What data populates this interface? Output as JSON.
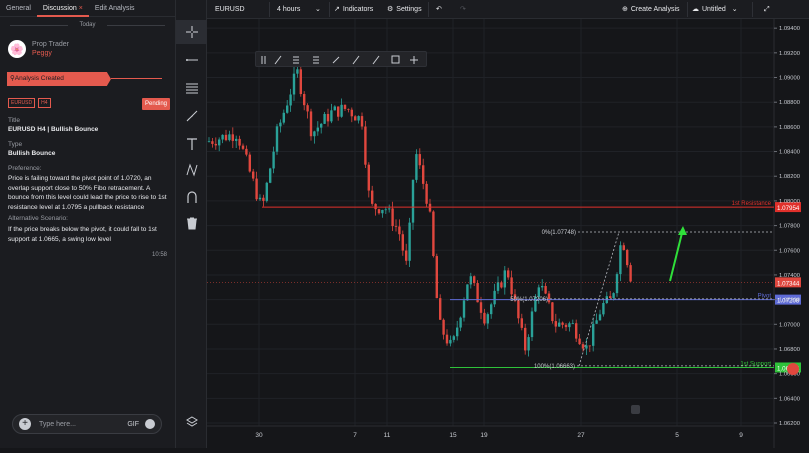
{
  "left_panel": {
    "tabs": [
      {
        "label": "General"
      },
      {
        "label": "Discussion",
        "close": "×"
      },
      {
        "label": "Edit Analysis"
      }
    ],
    "day_label": "Today",
    "user": {
      "role": "Prop Trader",
      "name": "Peggy"
    },
    "status_banner": "Analysis Created",
    "tags": [
      "EURUSD",
      "H4"
    ],
    "status_badge": "Pending",
    "title_label": "Title",
    "title_value": "EURUSD H4 | Bullish Bounce",
    "type_label": "Type",
    "type_value": "Bullish Bounce",
    "preference_label": "Preference:",
    "preference_text": "Price is failing toward the pivot point of 1.0720, an overlap support close to 50% Fibo retracement. A bounce from this level could lead the price to rise to 1st resistance level at 1.0795 a pullback resistance",
    "alt_label": "Alternative Scenario:",
    "alt_text": "If the price breaks below the pivot, it could fall  to 1st support at 1.0665, a swing low  level",
    "time": "10:58",
    "input_placeholder": "Type here...",
    "gif_label": "GIF"
  },
  "topbar": {
    "symbol": "EURUSD",
    "timeframe": "4 hours",
    "indicators": "Indicators",
    "settings": "Settings",
    "create_analysis": "Create Analysis",
    "layout_name": "Untitled"
  },
  "chart_data": {
    "type": "candlestick",
    "symbol": "EURUSD",
    "timeframe": "H4",
    "y_axis": {
      "min": 1.062,
      "max": 1.0945,
      "ticks": [
        "1.09400",
        "1.09200",
        "1.09000",
        "1.08800",
        "1.08600",
        "1.08400",
        "1.08200",
        "1.08000",
        "1.07800",
        "1.07600",
        "1.07400",
        "1.07200",
        "1.07000",
        "1.06800",
        "1.06600",
        "1.06400",
        "1.06200"
      ]
    },
    "x_axis": {
      "ticks": [
        "30",
        "7",
        "11",
        "15",
        "19",
        "27",
        "5",
        "9"
      ]
    },
    "levels": [
      {
        "name": "1st Resistance",
        "value": 1.0795,
        "label": "1.07954",
        "color": "#e0302b"
      },
      {
        "name": "Pivot",
        "value": 1.072,
        "label": "1.07208",
        "color": "#5e6bd6"
      },
      {
        "name": "1st Support",
        "value": 1.0665,
        "label": "1.06654",
        "color": "#2fc23a"
      }
    ],
    "current_price": {
      "value": 1.0734,
      "label": "1.07344"
    },
    "fibonacci": [
      {
        "label": "0%(1.07748)",
        "value": 1.07748
      },
      {
        "label": "50%(1.07206)",
        "value": 1.07206
      },
      {
        "label": "100%(1.06663)",
        "value": 1.06663
      }
    ],
    "colors": {
      "up": "#2aa198",
      "down": "#e0473e",
      "background": "#151619",
      "grid": "#202227"
    }
  }
}
